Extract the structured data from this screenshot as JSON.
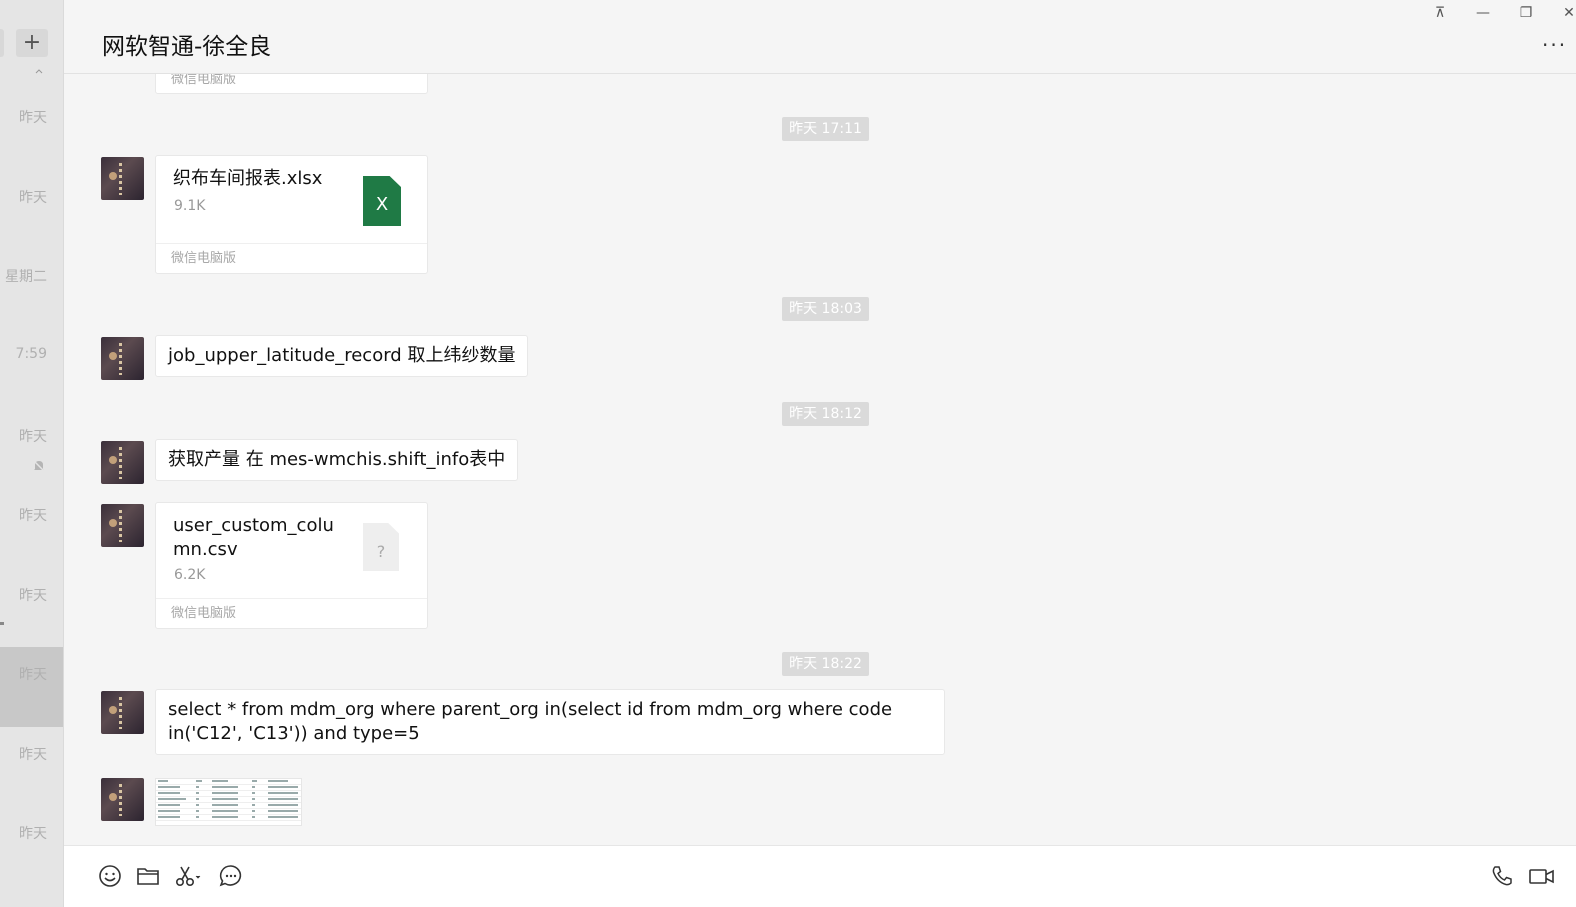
{
  "sidebar": {
    "add_label": "+",
    "sessions": [
      {
        "time": "昨天"
      },
      {
        "time": "昨天"
      },
      {
        "time": "星期二"
      },
      {
        "time": "7:59"
      },
      {
        "time": "昨天"
      },
      {
        "time": "昨天"
      },
      {
        "time": "昨天"
      },
      {
        "time": "昨天"
      },
      {
        "time": "昨天"
      },
      {
        "time": "昨天"
      }
    ]
  },
  "header": {
    "title": "网软智通-徐全良",
    "pin": "⊼",
    "minimize": "—",
    "restore": "❐",
    "close": "✕",
    "more": "···"
  },
  "chat": {
    "top_card_footer": "微信电脑版",
    "messages": [
      {
        "timestamp": "昨天 17:11"
      },
      {
        "type": "file",
        "name": "织布车间报表.xlsx",
        "size": "9.1K",
        "icon": "excel-icon",
        "footer": "微信电脑版"
      },
      {
        "timestamp": "昨天 18:03"
      },
      {
        "type": "text",
        "text": "job_upper_latitude_record 取上纬纱数量"
      },
      {
        "timestamp": "昨天 18:12"
      },
      {
        "type": "text",
        "text": "获取产量 在 mes-wmchis.shift_info表中"
      },
      {
        "type": "file",
        "name": "user_custom_column.csv",
        "size": "6.2K",
        "icon": "unknown-file-icon",
        "icon_glyph": "?",
        "footer": "微信电脑版"
      },
      {
        "timestamp": "昨天 18:22"
      },
      {
        "type": "text",
        "text": "select * from mdm_org where parent_org in(select id from mdm_org where code in('C12', 'C13')) and type=5"
      },
      {
        "type": "image",
        "description_icon": "spreadsheet-thumbnail"
      }
    ],
    "xls_glyph": "X"
  },
  "toolbar": {
    "left_icons": [
      "emoji-icon",
      "folder-icon",
      "scissors-icon",
      "chat-history-icon"
    ],
    "right_icons": [
      "phone-icon",
      "video-icon"
    ]
  },
  "colors": {
    "sidebar_bg": "#e5e5e5",
    "chat_bg": "#f5f5f5",
    "excel_green": "#1f7a45",
    "timestamp_bg": "#dadada"
  }
}
